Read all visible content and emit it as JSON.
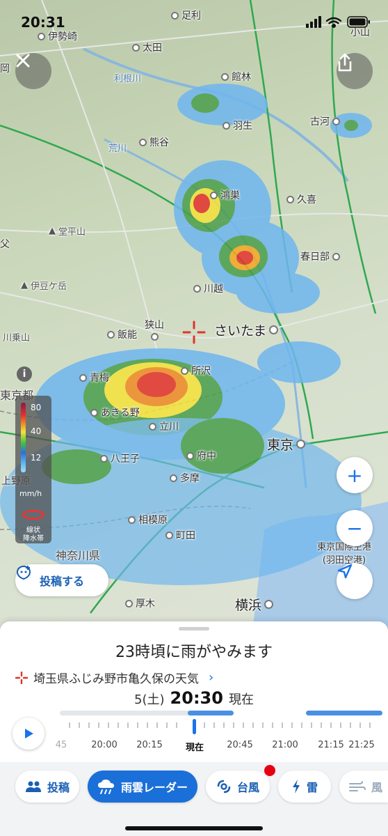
{
  "status_bar": {
    "time": "20:31"
  },
  "map": {
    "places": [
      {
        "name": "伊勢崎",
        "kind": "city"
      },
      {
        "name": "太田",
        "kind": "city"
      },
      {
        "name": "足利",
        "kind": "city"
      },
      {
        "name": "小山",
        "kind": "city"
      },
      {
        "name": "館林",
        "kind": "city"
      },
      {
        "name": "羽生",
        "kind": "city"
      },
      {
        "name": "古河",
        "kind": "city"
      },
      {
        "name": "熊谷",
        "kind": "city"
      },
      {
        "name": "鴻巣",
        "kind": "city"
      },
      {
        "name": "久喜",
        "kind": "city"
      },
      {
        "name": "春日部",
        "kind": "city"
      },
      {
        "name": "川越",
        "kind": "city"
      },
      {
        "name": "飯能",
        "kind": "city"
      },
      {
        "name": "狭山",
        "kind": "city"
      },
      {
        "name": "さいたま",
        "kind": "big"
      },
      {
        "name": "所沢",
        "kind": "city"
      },
      {
        "name": "青梅",
        "kind": "city"
      },
      {
        "name": "あきる野",
        "kind": "city"
      },
      {
        "name": "立川",
        "kind": "city"
      },
      {
        "name": "東京",
        "kind": "big"
      },
      {
        "name": "八王子",
        "kind": "city"
      },
      {
        "name": "府中",
        "kind": "city"
      },
      {
        "name": "多摩",
        "kind": "city"
      },
      {
        "name": "相模原",
        "kind": "city"
      },
      {
        "name": "町田",
        "kind": "city"
      },
      {
        "name": "厚木",
        "kind": "city"
      },
      {
        "name": "横浜",
        "kind": "big"
      },
      {
        "name": "利根川",
        "kind": "river"
      },
      {
        "name": "荒川",
        "kind": "river"
      },
      {
        "name": "堂平山",
        "kind": "mount"
      },
      {
        "name": "伊豆ケ岳",
        "kind": "mount"
      },
      {
        "name": "東京都",
        "kind": "pref"
      },
      {
        "name": "神奈川県",
        "kind": "pref"
      },
      {
        "name": "東京国際空港",
        "kind": "airport"
      },
      {
        "name": "(羽田空港)",
        "kind": "airport"
      },
      {
        "name": "上野原",
        "kind": "city"
      },
      {
        "name": "川乗山",
        "kind": "mount"
      },
      {
        "name": "父",
        "kind": "edge"
      },
      {
        "name": "岡",
        "kind": "edge"
      }
    ],
    "legend": {
      "ticks": [
        "80",
        "40",
        "12"
      ],
      "unit": "mm/h",
      "linear_label_1": "線状",
      "linear_label_2": "降水帯"
    },
    "post_button": "投稿する"
  },
  "sheet": {
    "headline": "23時頃に雨がやみます",
    "location": "埼玉県ふじみ野市亀久保の天気",
    "date": "5(土)",
    "time": "20:30",
    "now_suffix": "現在",
    "timeline_labels": [
      "45",
      "20:00",
      "20:15",
      "現在",
      "20:45",
      "21:00",
      "21:15",
      "21:25"
    ]
  },
  "tabs": [
    {
      "label": "投稿",
      "icon": "people-icon",
      "active": false
    },
    {
      "label": "雨雲レーダー",
      "icon": "rain-cloud-icon",
      "active": true
    },
    {
      "label": "台風",
      "icon": "typhoon-icon",
      "active": false,
      "badge": true
    },
    {
      "label": "雷",
      "icon": "lightning-icon",
      "active": false
    },
    {
      "label": "風",
      "icon": "wind-icon",
      "active": false
    }
  ],
  "colors": {
    "accent": "#1a73e8",
    "badge": "#e60012"
  }
}
